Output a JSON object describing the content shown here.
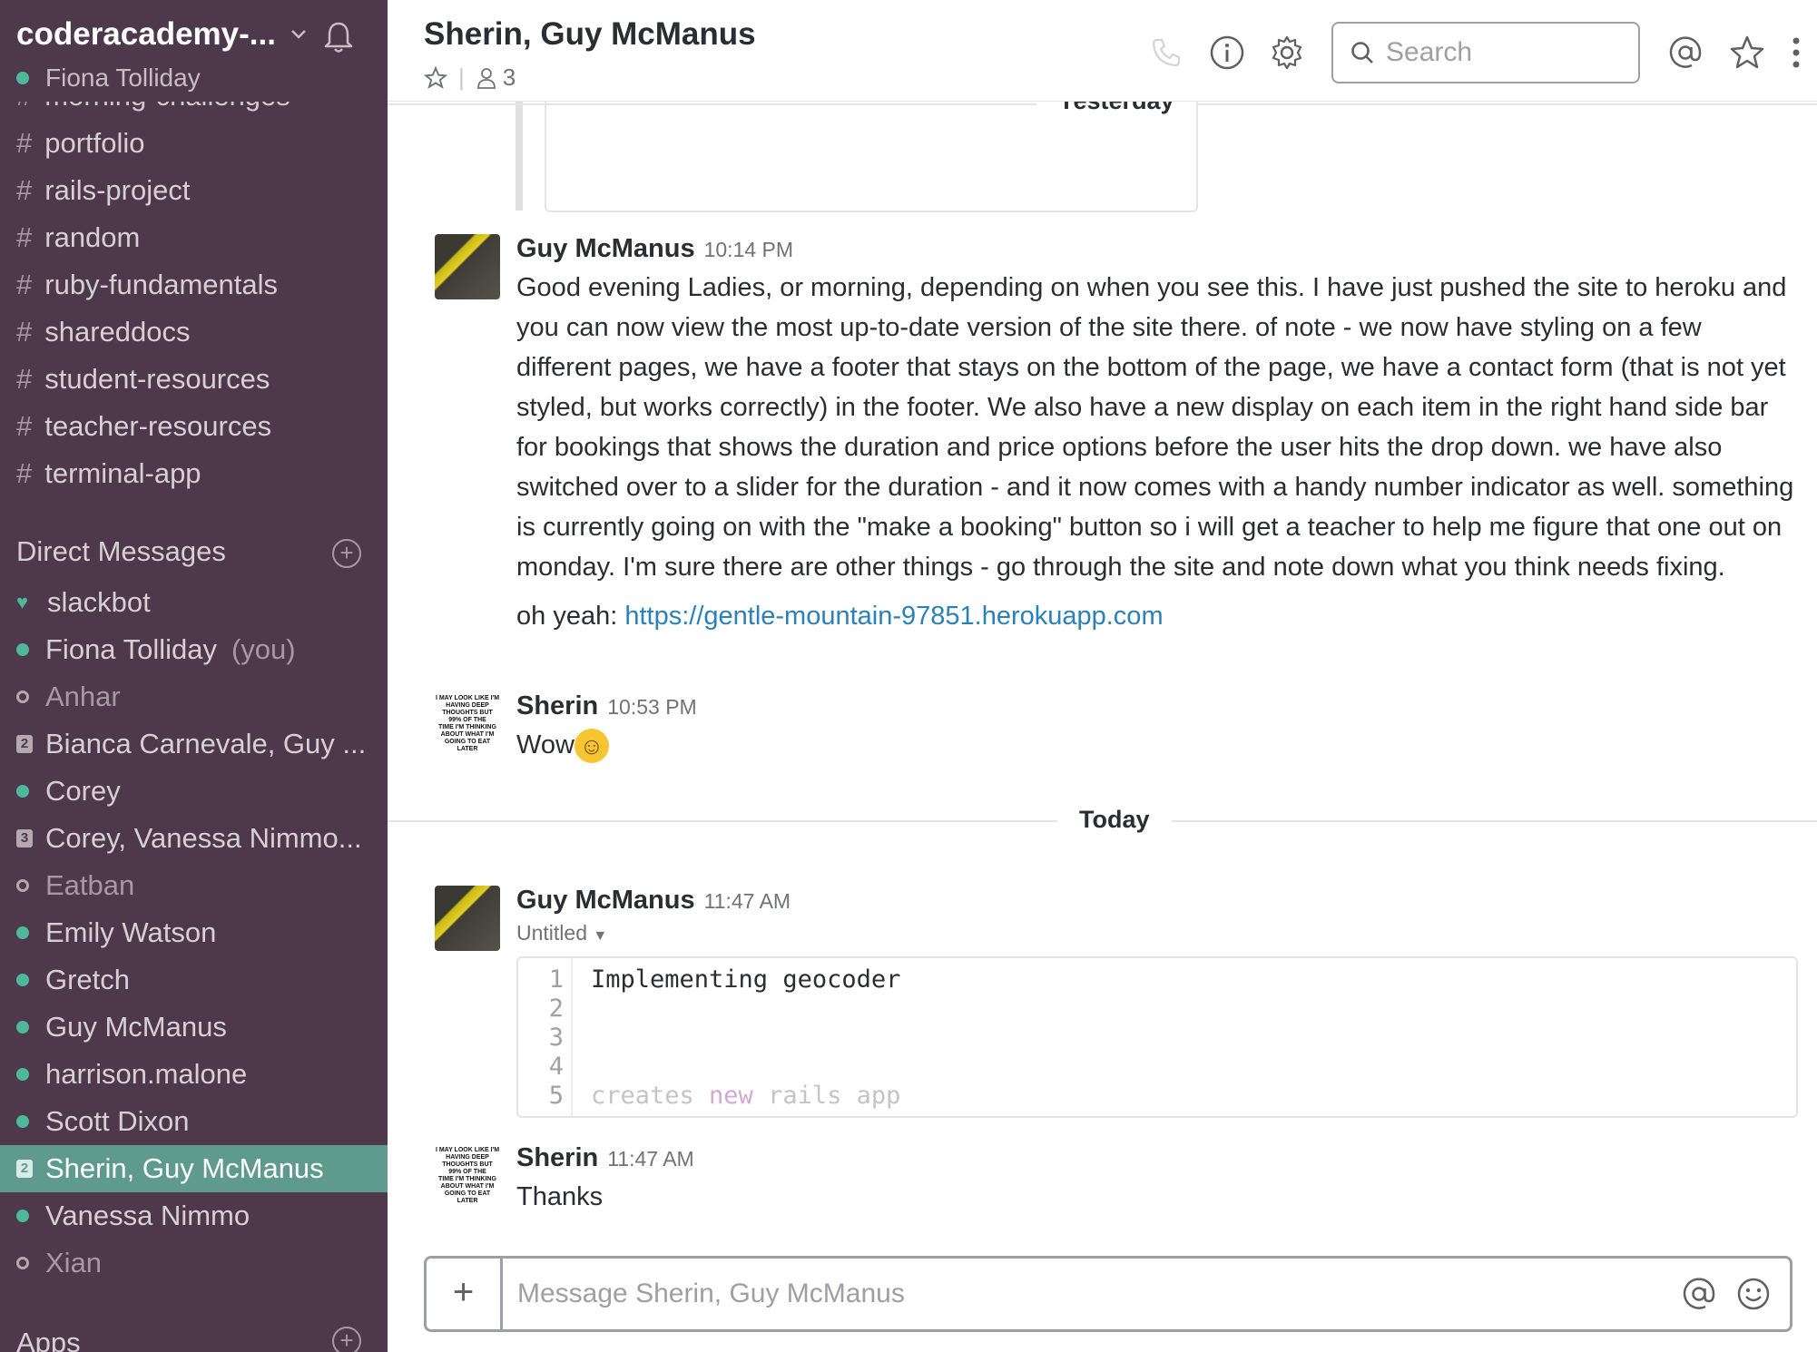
{
  "team": {
    "name": "coderacademy-...",
    "user": "Fiona Tolliday"
  },
  "sidebar": {
    "partial_channel": "morning-challenges",
    "channels": [
      {
        "label": "portfolio"
      },
      {
        "label": "rails-project"
      },
      {
        "label": "random"
      },
      {
        "label": "ruby-fundamentals"
      },
      {
        "label": "shareddocs"
      },
      {
        "label": "student-resources"
      },
      {
        "label": "teacher-resources"
      },
      {
        "label": "terminal-app"
      }
    ],
    "dm_title": "Direct Messages",
    "dms": [
      {
        "label": "slackbot",
        "status": "bot"
      },
      {
        "label": "Fiona Tolliday",
        "status": "online",
        "suffix": "(you)"
      },
      {
        "label": "Anhar",
        "status": "away"
      },
      {
        "label": "Bianca Carnevale, Guy ...",
        "status": "group",
        "count": "2"
      },
      {
        "label": "Corey",
        "status": "online"
      },
      {
        "label": "Corey, Vanessa Nimmo...",
        "status": "group",
        "count": "3"
      },
      {
        "label": "Eatban",
        "status": "away"
      },
      {
        "label": "Emily Watson",
        "status": "online"
      },
      {
        "label": "Gretch",
        "status": "online"
      },
      {
        "label": "Guy McManus",
        "status": "online"
      },
      {
        "label": "harrison.malone",
        "status": "online"
      },
      {
        "label": "Scott Dixon",
        "status": "online"
      },
      {
        "label": "Sherin, Guy McManus",
        "status": "group",
        "count": "2",
        "active": true
      },
      {
        "label": "Vanessa Nimmo",
        "status": "online"
      },
      {
        "label": "Xian",
        "status": "away"
      }
    ],
    "apps_title": "Apps"
  },
  "header": {
    "title": "Sherin, Guy McManus",
    "member_count": "3",
    "search_placeholder": "Search"
  },
  "messages": {
    "day_yesterday": "Yesterday",
    "day_today": "Today",
    "m1": {
      "author": "Guy McManus",
      "time": "10:14 PM",
      "text": "Good evening Ladies, or morning, depending on when you see this.  I have just pushed the site to heroku and you can now view the most up-to-date version of the site there.  of note - we now have styling on a few different pages, we have a footer that stays on the bottom of the page, we have a contact form (that is not yet styled, but works correctly) in the footer.  We also have a new display on each item in the right hand side bar for bookings that shows the duration and price options before the user hits the drop down.  we have also switched over to a slider for the duration - and it now comes with a handy number indicator as well.  something is currently going on with the \"make a booking\" button so i will get a teacher to help me figure that one out on monday.  I'm sure there are other things - go through the site and note down what you think needs fixing.",
      "text2_prefix": "oh yeah: ",
      "link": "https://gentle-mountain-97851.herokuapp.com"
    },
    "m2": {
      "author": "Sherin",
      "time": "10:53 PM",
      "text": "Wow",
      "emoji": "☺"
    },
    "m3": {
      "author": "Guy McManus",
      "time": "11:47 AM",
      "snippet_title": "Untitled",
      "line_numbers": [
        "1",
        "2",
        "3",
        "4",
        "5"
      ],
      "code_line1": "Implementing geocoder",
      "code_line5a": "creates ",
      "code_line5b": "new",
      "code_line5c": " rails app"
    },
    "m4": {
      "author": "Sherin",
      "time": "11:47 AM",
      "text": "Thanks"
    }
  },
  "sherin_avatar_text": [
    "I MAY LOOK LIKE I'M",
    "HAVING DEEP",
    "THOUGHTS BUT",
    "99% OF THE",
    "TIME I'M THINKING",
    "ABOUT WHAT I'M",
    "GOING TO EAT LATER"
  ],
  "composer": {
    "placeholder": "Message Sherin, Guy McManus"
  },
  "colors": {
    "sidebar_bg": "#4d394b",
    "active_item": "#5f9b8c",
    "presence_online": "#4fb89b",
    "link": "#2a80b9"
  }
}
